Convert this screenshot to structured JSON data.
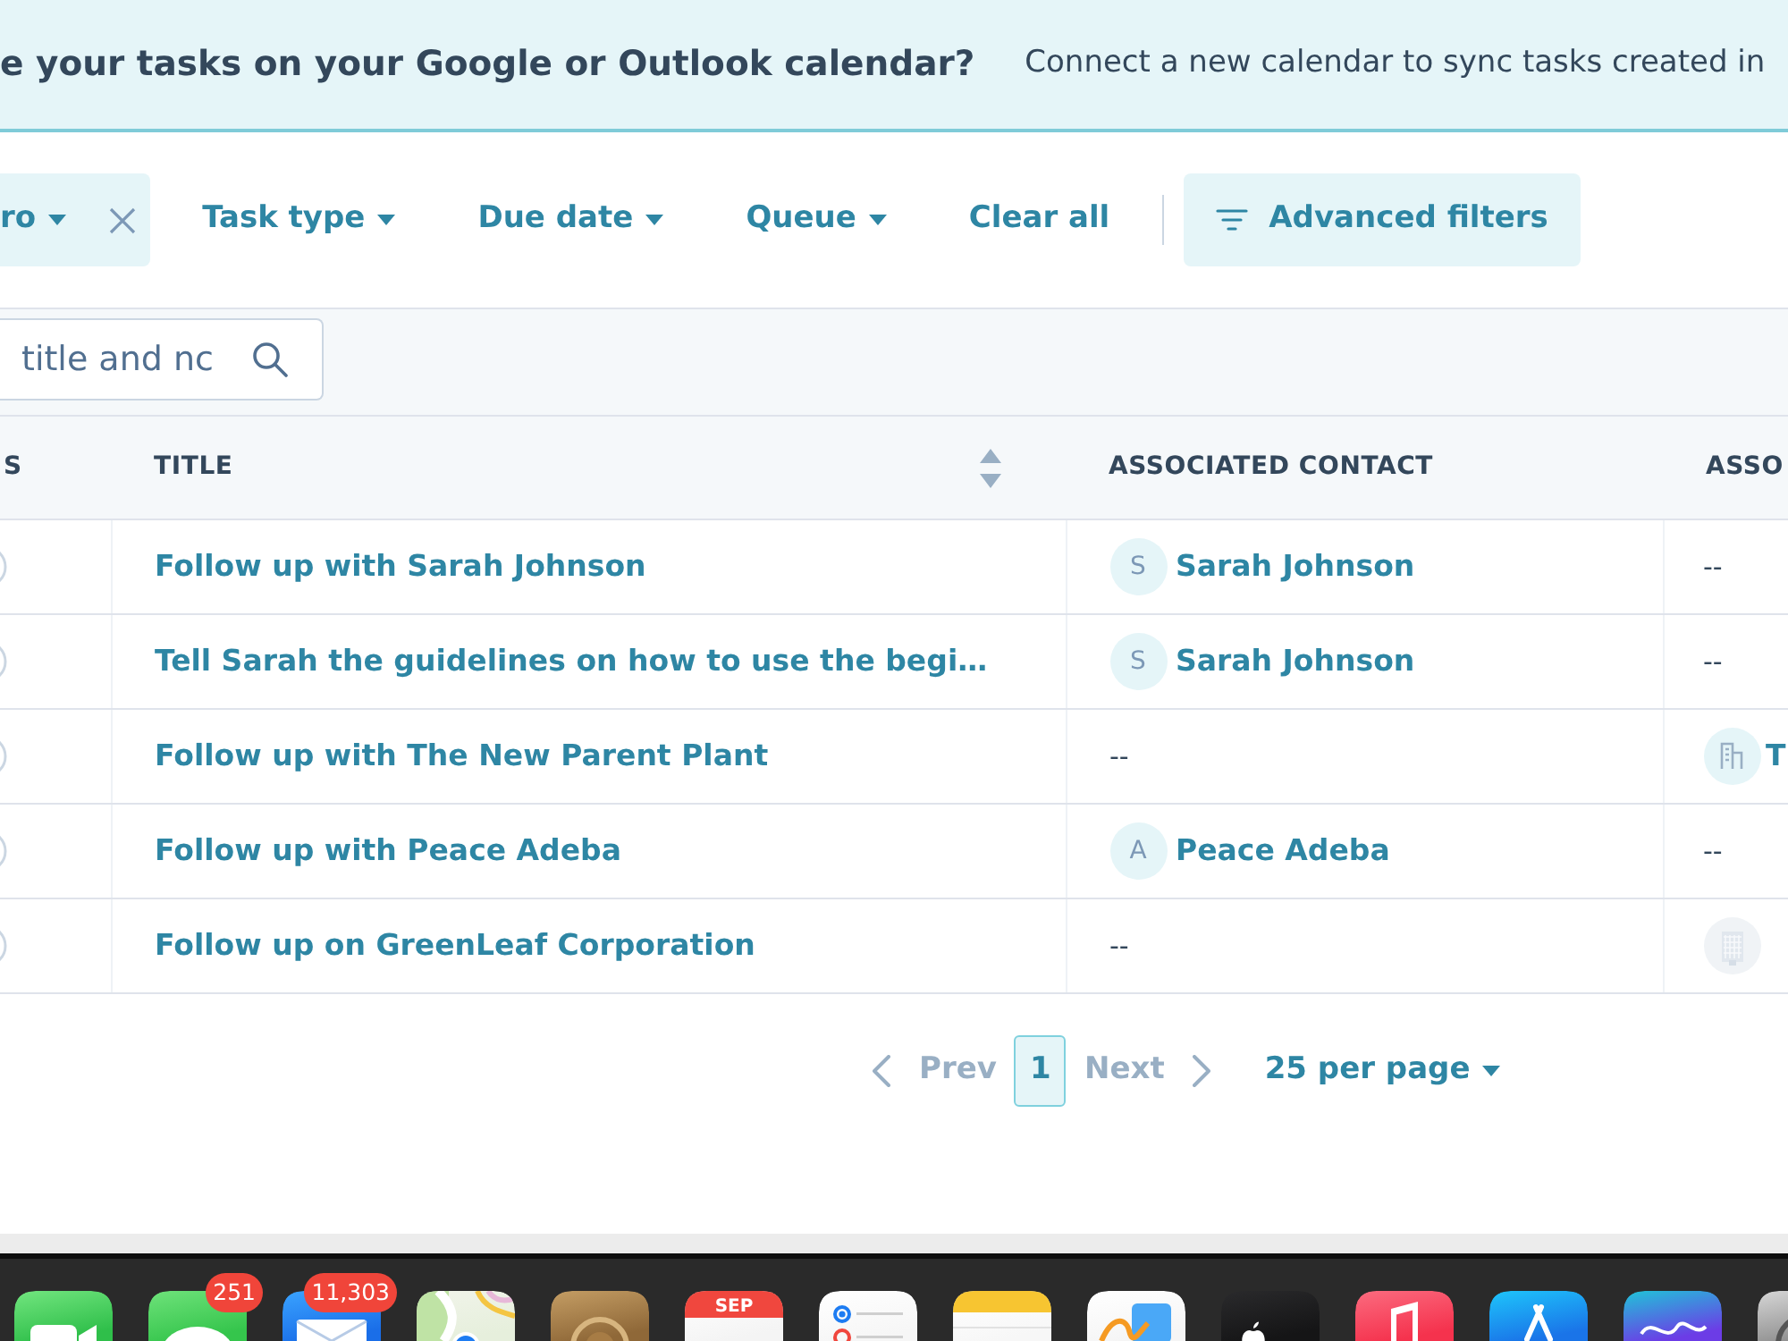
{
  "banner": {
    "heading": "e your tasks on your Google or Outlook calendar?",
    "text": "Connect a new calendar to sync tasks created in"
  },
  "filters": [
    {
      "kind": "active",
      "label": "ro"
    },
    {
      "kind": "dropdown",
      "label": "Task type"
    },
    {
      "kind": "dropdown",
      "label": "Due date"
    },
    {
      "kind": "dropdown",
      "label": "Queue"
    },
    {
      "kind": "link",
      "label": "Clear all"
    },
    {
      "kind": "button",
      "label": "Advanced filters"
    }
  ],
  "search": {
    "placeholder": "title and nc"
  },
  "table": {
    "columns": [
      {
        "label": "S",
        "sortable": false
      },
      {
        "label": "TITLE",
        "sortable": true
      },
      {
        "label": "ASSOCIATED CONTACT",
        "sortable": false
      },
      {
        "label": "ASSO",
        "sortable": false
      }
    ],
    "rows": [
      {
        "completed": false,
        "title": "Follow up with Sarah Johnson",
        "contact": {
          "kind": "person",
          "initial": "S",
          "name": "Sarah Johnson"
        },
        "company": {
          "kind": "empty",
          "text": "--"
        }
      },
      {
        "completed": false,
        "title": "Tell Sarah the guidelines on how to use the begi…",
        "contact": {
          "kind": "person",
          "initial": "S",
          "name": "Sarah Johnson"
        },
        "company": {
          "kind": "empty",
          "text": "--"
        }
      },
      {
        "completed": false,
        "title": "Follow up with The New Parent Plant",
        "contact": {
          "kind": "empty",
          "text": "--"
        },
        "company": {
          "kind": "company",
          "name": "T"
        }
      },
      {
        "completed": false,
        "title": "Follow up with Peace Adeba",
        "contact": {
          "kind": "person",
          "initial": "A",
          "name": "Peace Adeba"
        },
        "company": {
          "kind": "empty",
          "text": "--"
        }
      },
      {
        "completed": false,
        "title": "Follow up on GreenLeaf Corporation",
        "contact": {
          "kind": "empty",
          "text": "--"
        },
        "company": {
          "kind": "company_no_logo"
        }
      }
    ]
  },
  "pagination": {
    "prev": {
      "label": "Prev",
      "disabled": true
    },
    "pages": [
      {
        "label": "1",
        "selected": true
      }
    ],
    "next": {
      "label": "Next",
      "disabled": true
    },
    "per_page": "25 per page"
  },
  "dock": {
    "apps": [
      {
        "kind": "facetime"
      },
      {
        "kind": "messages",
        "badge": "251"
      },
      {
        "kind": "mail",
        "badge": "11,303"
      },
      {
        "kind": "maps"
      },
      {
        "kind": "contacts"
      },
      {
        "kind": "calendar",
        "month": "SEP"
      },
      {
        "kind": "reminders"
      },
      {
        "kind": "notes"
      },
      {
        "kind": "freeform"
      },
      {
        "kind": "tv"
      },
      {
        "kind": "music"
      },
      {
        "kind": "app_store"
      },
      {
        "kind": "canva"
      },
      {
        "kind": "settings"
      }
    ]
  }
}
